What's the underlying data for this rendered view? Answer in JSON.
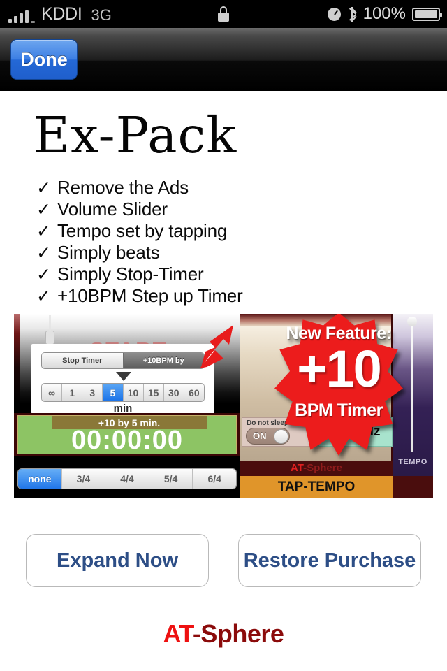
{
  "status_bar": {
    "carrier": "KDDI",
    "network": "3G",
    "battery_percent": "100%",
    "icons": [
      "signal-bars-icon",
      "lock-icon",
      "alarm-clock-icon",
      "bluetooth-icon",
      "battery-icon"
    ]
  },
  "nav_bar": {
    "done_label": "Done"
  },
  "page": {
    "title": "Ex-Pack",
    "features": [
      {
        "check": "✓",
        "label": "Remove the Ads"
      },
      {
        "check": "✓",
        "label": "Volume Slider"
      },
      {
        "check": "✓",
        "label": "Tempo set by tapping"
      },
      {
        "check": "✓",
        "label": "Simply beats"
      },
      {
        "check": "✓",
        "label": "Simply Stop-Timer"
      },
      {
        "check": "✓",
        "label": "+10BPM Step up Timer"
      }
    ]
  },
  "screenshot": {
    "start_ghost_label": "START",
    "popover": {
      "mode_segments": [
        {
          "label": "Stop Timer",
          "selected": false
        },
        {
          "label": "+10BPM by",
          "selected": true
        }
      ],
      "minute_options": [
        {
          "label": "∞",
          "selected": false
        },
        {
          "label": "1",
          "selected": false
        },
        {
          "label": "3",
          "selected": false
        },
        {
          "label": "5",
          "selected": true
        },
        {
          "label": "10",
          "selected": false
        },
        {
          "label": "15",
          "selected": false
        },
        {
          "label": "30",
          "selected": false
        },
        {
          "label": "60",
          "selected": false
        }
      ],
      "unit_label": "min"
    },
    "timer": {
      "sub_label": "+10 by 5 min.",
      "digits": "00:00:00"
    },
    "beat_segments": [
      {
        "label": "none",
        "selected": true
      },
      {
        "label": "3/4",
        "selected": false
      },
      {
        "label": "4/4",
        "selected": false
      },
      {
        "label": "5/4",
        "selected": false
      },
      {
        "label": "6/4",
        "selected": false
      }
    ],
    "tone_panel": {
      "sleep_label": "Do not sleep",
      "toggle_state": "ON",
      "hz_label": "440Hz"
    },
    "mini_brand": {
      "primary": "AT",
      "secondary": "-Sphere"
    },
    "tap_tempo_label": "TAP-TEMPO",
    "tempo_label": "TEMPO",
    "badge": {
      "line1": "New Feature:",
      "line2": "+10",
      "line3": "BPM Timer",
      "color": "#ec1c1c"
    }
  },
  "actions": {
    "expand_label": "Expand Now",
    "restore_label": "Restore Purchase",
    "accent_color": "#2d4e86"
  },
  "brand": {
    "primary": "AT",
    "secondary": "-Sphere",
    "primary_color": "#ee1111",
    "secondary_color": "#8b0b0b"
  }
}
